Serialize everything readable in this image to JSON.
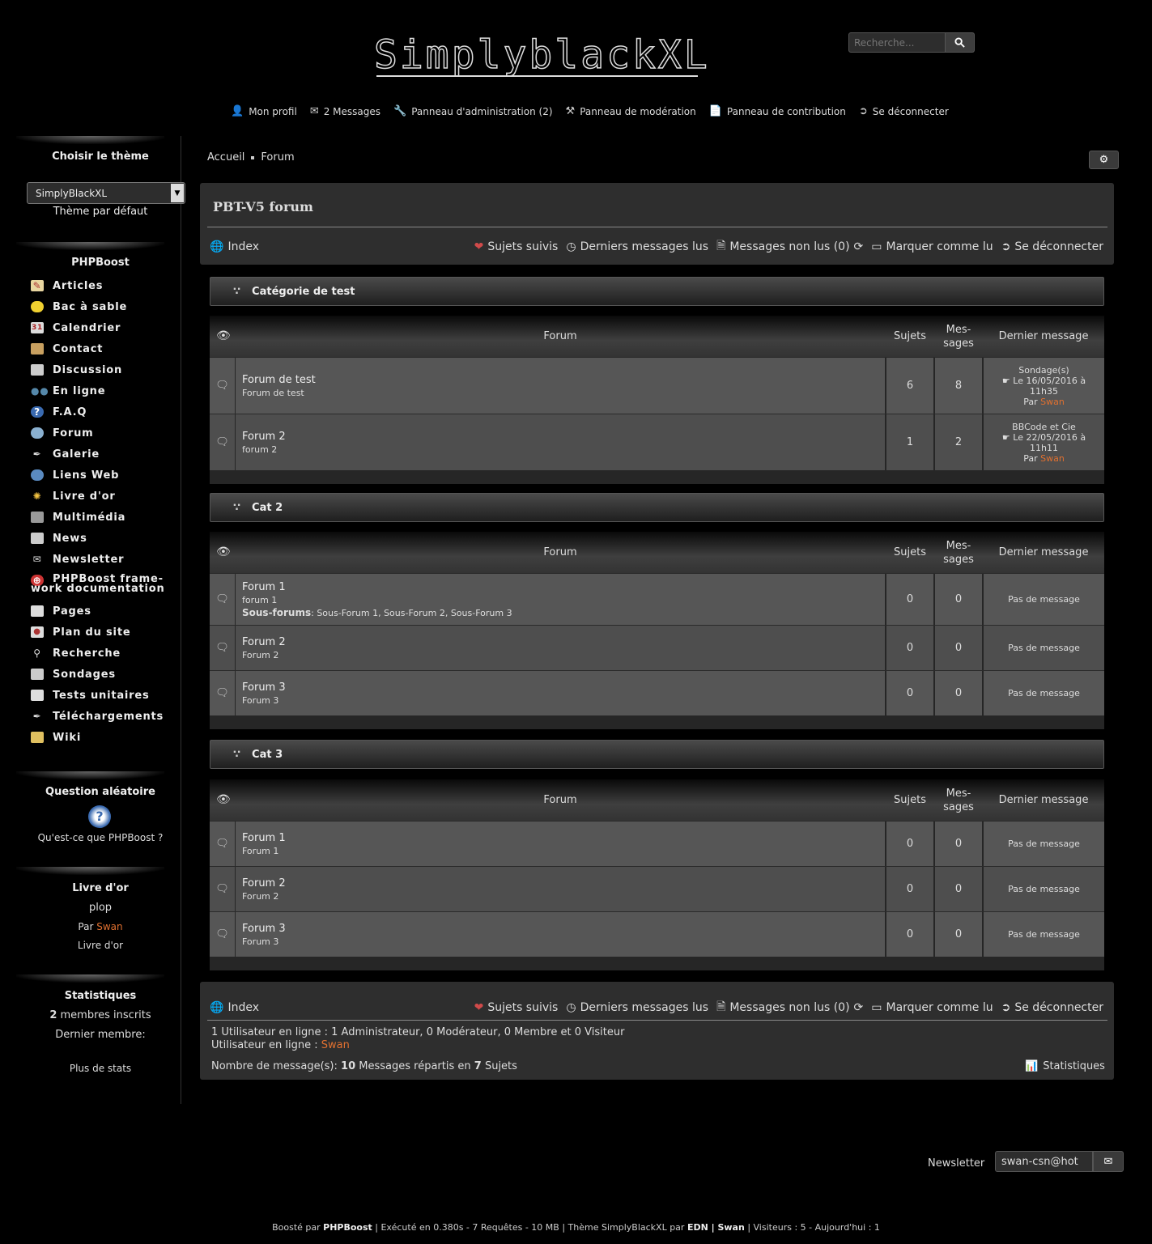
{
  "header": {
    "logo": "SimplyblackXL",
    "search_placeholder": "Recherche...",
    "nav": [
      {
        "label": "Mon profil",
        "icon": "user-icon"
      },
      {
        "label": "2 Messages",
        "icon": "envelope-icon"
      },
      {
        "label": "Panneau d'administration (2)",
        "icon": "wrench-icon"
      },
      {
        "label": "Panneau de modération",
        "icon": "gavel-icon"
      },
      {
        "label": "Panneau de contribution",
        "icon": "file-icon"
      },
      {
        "label": "Se déconnecter",
        "icon": "sign-out-icon"
      }
    ]
  },
  "sidebar": {
    "theme_title": "Choisir le thème",
    "theme_selected": "SimplyBlackXL",
    "theme_default": "Thème par défaut",
    "menu_title": "PHPBoost",
    "menu": [
      "Articles",
      "Bac à sable",
      "Calendrier",
      "Contact",
      "Discussion",
      "En ligne",
      "F.A.Q",
      "Forum",
      "Galerie",
      "Liens Web",
      "Livre d'or",
      "Multimédia",
      "News",
      "Newsletter",
      "PHPBoost frame-",
      "work documentation",
      "Pages",
      "Plan du site",
      "Recherche",
      "Sondages",
      "Tests unitaires",
      "Téléchargements",
      "Wiki"
    ],
    "question_title": "Question aléatoire",
    "question_text": "Qu'est-ce que PHPBoost ?",
    "guestbook_title": "Livre d'or",
    "guestbook_msg": "plop",
    "guestbook_by": "Par",
    "guestbook_author": "Swan",
    "guestbook_link": "Livre d'or",
    "stats_title": "Statistiques",
    "stats_members_count": "2",
    "stats_members_label": "membres inscrits",
    "stats_last_member": "Dernier membre:",
    "stats_more": "Plus de stats"
  },
  "breadcrumb": [
    "Accueil",
    "Forum"
  ],
  "forum": {
    "title": "PBT-V5 forum",
    "nav": {
      "index": "Index",
      "followed": "Sujets suivis",
      "last_read": "Derniers messages lus",
      "unread": "Messages non lus (0)",
      "mark_read": "Marquer comme lu",
      "logout": "Se déconnecter"
    },
    "headers": {
      "forum": "Forum",
      "topics": "Sujets",
      "messages_1": "Mes-",
      "messages_2": "sages",
      "last": "Dernier message"
    },
    "categories": [
      {
        "name": "Catégorie de test",
        "forums": [
          {
            "name": "Forum de test",
            "desc": "Forum de test",
            "topics": "6",
            "messages": "8",
            "last_title": "Sondage(s)",
            "last_date_1": "Le 16/05/2016 à",
            "last_date_2": "11h35",
            "last_by": "Par",
            "last_author": "Swan"
          },
          {
            "name": "Forum 2",
            "desc": "forum 2",
            "topics": "1",
            "messages": "2",
            "last_title": "BBCode et Cie",
            "last_date_1": "Le 22/05/2016 à",
            "last_date_2": "11h11",
            "last_by": "Par",
            "last_author": "Swan"
          }
        ]
      },
      {
        "name": "Cat 2",
        "forums": [
          {
            "name": "Forum 1",
            "desc": "forum 1",
            "sub_label": "Sous-forums",
            "sub_list": "Sous-Forum 1, Sous-Forum 2, Sous-Forum 3",
            "topics": "0",
            "messages": "0",
            "none": "Pas de message"
          },
          {
            "name": "Forum 2",
            "desc": "Forum 2",
            "topics": "0",
            "messages": "0",
            "none": "Pas de message"
          },
          {
            "name": "Forum 3",
            "desc": "Forum 3",
            "topics": "0",
            "messages": "0",
            "none": "Pas de message"
          }
        ]
      },
      {
        "name": "Cat 3",
        "forums": [
          {
            "name": "Forum 1",
            "desc": "Forum 1",
            "topics": "0",
            "messages": "0",
            "none": "Pas de message"
          },
          {
            "name": "Forum 2",
            "desc": "Forum 2",
            "topics": "0",
            "messages": "0",
            "none": "Pas de message"
          },
          {
            "name": "Forum 3",
            "desc": "Forum 3",
            "topics": "0",
            "messages": "0",
            "none": "Pas de message"
          }
        ]
      }
    ],
    "online_line": "1 Utilisateur en ligne : 1 Administrateur, 0 Modérateur, 0 Membre et 0 Visiteur",
    "online_users_label": "Utilisateur en ligne :",
    "online_user": "Swan",
    "msg_count_label": "Nombre de message(s):",
    "msg_count": "10",
    "msg_spread": "Messages répartis en",
    "topic_count": "7",
    "topic_label": "Sujets",
    "stats_link": "Statistiques"
  },
  "newsletter": {
    "label": "Newsletter",
    "value": "swan-csn@hot"
  },
  "footer": {
    "p1": "Boosté par",
    "b1": "PHPBoost",
    "p2": "| Exécuté en 0.380s - 7 Requêtes - 10 MB | Thème SimplyBlackXL par",
    "b2": "EDN | Swan",
    "p3": "| Visiteurs : 5 - Aujourd'hui : 1"
  },
  "colors": {
    "accent": "#e07030",
    "heart": "#d04a4a",
    "background": "#000000"
  }
}
